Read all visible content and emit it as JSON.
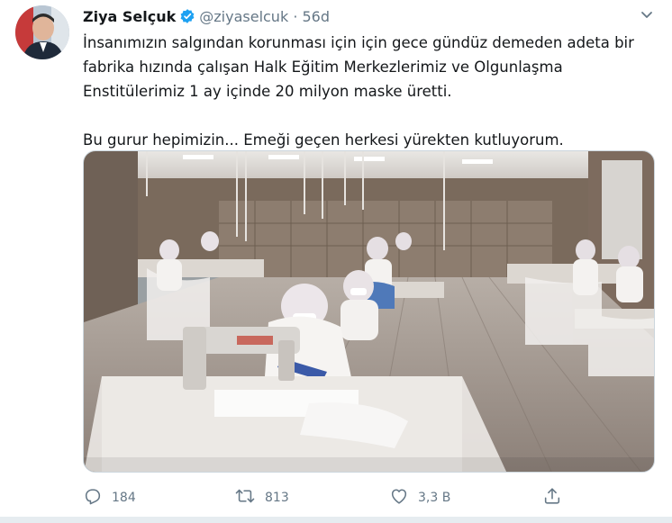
{
  "tweet": {
    "author_name": "Ziya Selçuk",
    "handle": "@ziyaselcuk",
    "separator": "·",
    "time": "56d",
    "text_lines": [
      "İnsanımızın salgından korunması için için gece gündüz demeden adeta bir",
      "fabrika hızında çalışan Halk Eğitim Merkezlerimiz ve Olgunlaşma",
      "Enstitülerimiz 1 ay içinde 20 milyon maske üretti.",
      "Bu gurur hepimizin... Emeği geçen herkesi yürekten kutluyorum."
    ],
    "media_description": "video",
    "actions": {
      "reply_count": "184",
      "retweet_count": "813",
      "like_count": "3,3 B"
    }
  },
  "icons": {
    "reply": "reply-icon",
    "retweet": "retweet-icon",
    "like": "heart-icon",
    "share": "share-icon",
    "verified": "verified-badge-icon",
    "more": "chevron-down-icon"
  },
  "colors": {
    "verified_blue": "#1da1f2",
    "muted": "#657786",
    "text": "#14171a"
  }
}
